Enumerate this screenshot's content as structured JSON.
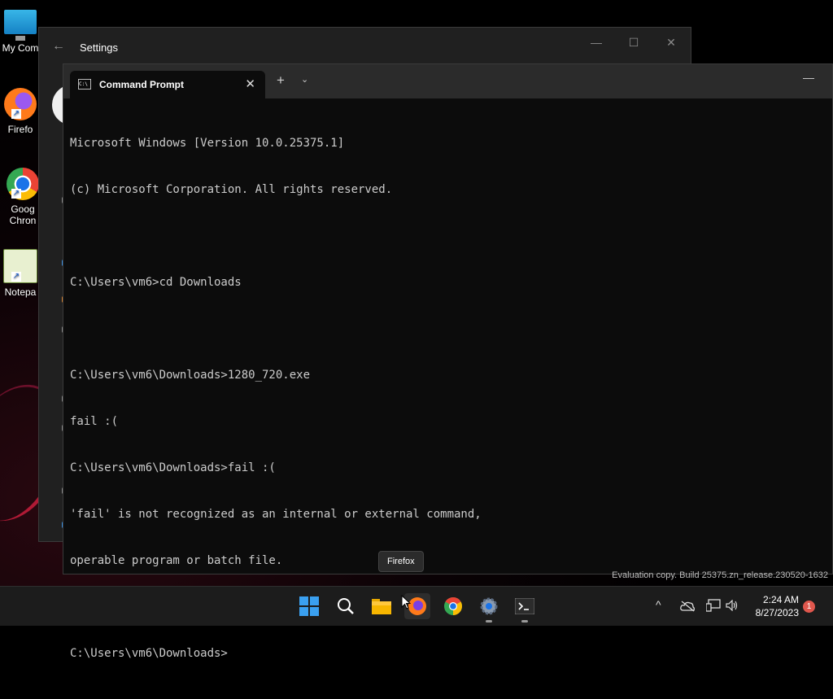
{
  "desktop": {
    "icons": [
      {
        "label": "My Com",
        "icon": "computer-icon"
      },
      {
        "label": "Firefo",
        "icon": "firefox-icon"
      },
      {
        "label": "Goog Chron",
        "icon": "chrome-icon"
      },
      {
        "label": "Notepa",
        "icon": "notepad-icon"
      }
    ]
  },
  "settings_window": {
    "title": "Settings",
    "controls": {
      "minimize": "—",
      "maximize": "☐",
      "close": "✕"
    }
  },
  "terminal": {
    "tab_label": "Command Prompt",
    "tab_icon_text": "C:\\",
    "tab_close": "✕",
    "new_tab": "+",
    "tab_menu": "⌄",
    "minimize": "—",
    "lines": [
      "Microsoft Windows [Version 10.0.25375.1]",
      "(c) Microsoft Corporation. All rights reserved.",
      "",
      "C:\\Users\\vm6>cd Downloads",
      "",
      "C:\\Users\\vm6\\Downloads>1280_720.exe",
      "fail :(",
      "C:\\Users\\vm6\\Downloads>fail :(",
      "'fail' is not recognized as an internal or external command,",
      "operable program or batch file.",
      "",
      "C:\\Users\\vm6\\Downloads>"
    ]
  },
  "tooltip": "Firefox",
  "watermark": "Evaluation copy. Build 25375.zn_release.230520-1632",
  "taskbar": {
    "items": [
      "start-icon",
      "search-icon",
      "file-explorer-icon",
      "firefox-icon",
      "chrome-icon",
      "settings-icon",
      "terminal-icon"
    ],
    "tray": {
      "chevron": "^",
      "time": "2:24 AM",
      "date": "8/27/2023",
      "notification_count": "1"
    }
  },
  "colors": {
    "accent": "#0078d4",
    "terminal_bg": "#0c0c0c",
    "terminal_text": "#cccccc",
    "taskbar_bg": "#1c1c1c"
  }
}
